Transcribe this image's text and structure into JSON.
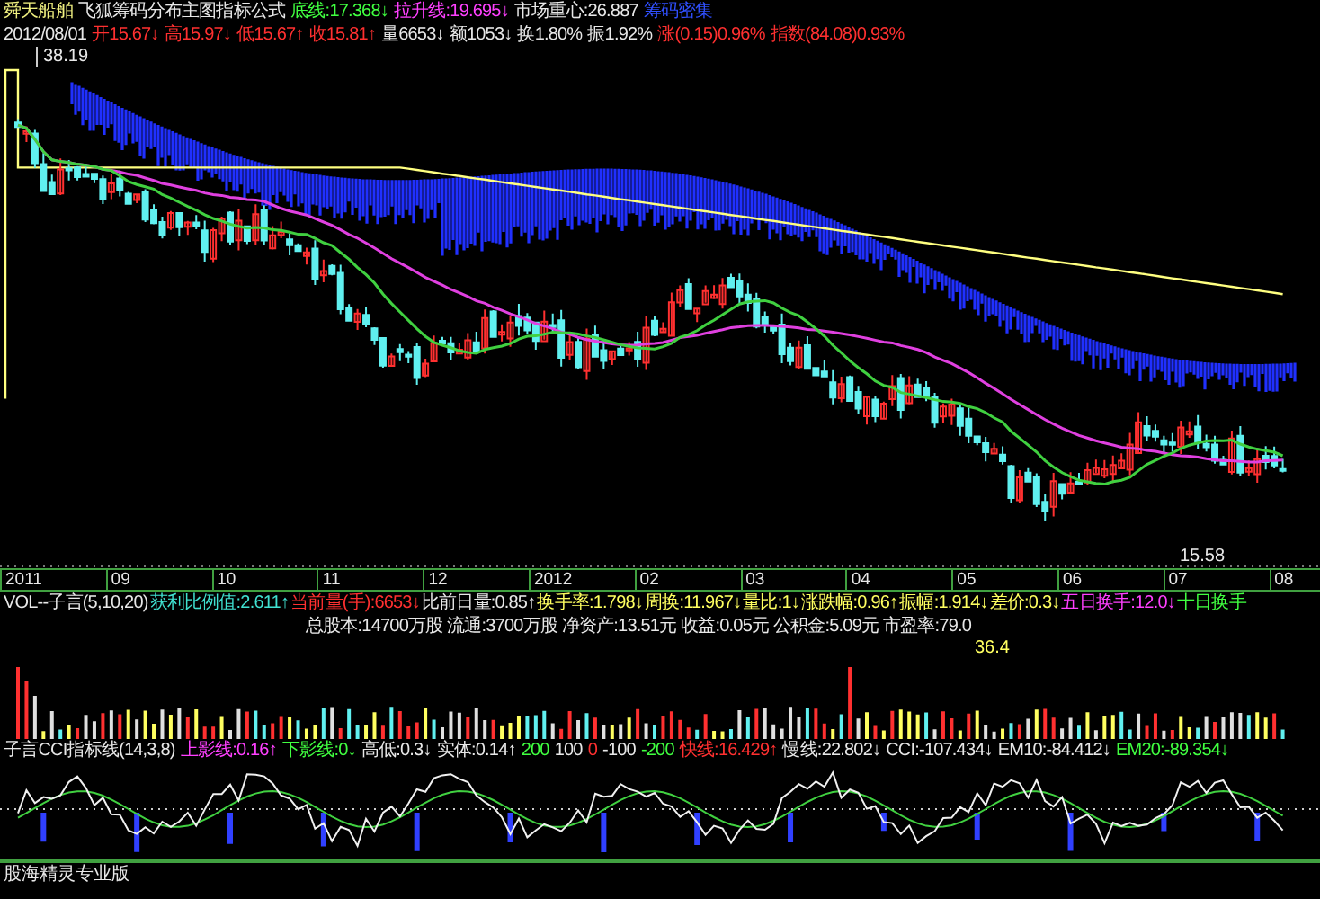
{
  "header": {
    "line_1": [
      {
        "text": "舜天船舶",
        "color": "#f0f080"
      },
      {
        "text": "飞狐筹码分布主图指标公式",
        "color": "#e8e8e8"
      },
      {
        "text": "底线:17.368↓",
        "color": "#40ff40"
      },
      {
        "text": "拉升线:19.695↓",
        "color": "#ff40ff"
      },
      {
        "text": "市场重心:26.887",
        "color": "#e8e8e8"
      },
      {
        "text": "筹码密集",
        "color": "#3050ff"
      }
    ],
    "line_2": [
      {
        "text": "2012/08/01",
        "color": "#e8e8e8"
      },
      {
        "text": "开15.67↓",
        "color": "#ff3030"
      },
      {
        "text": "高15.97↓",
        "color": "#ff3030"
      },
      {
        "text": "低15.67↑",
        "color": "#ff3030"
      },
      {
        "text": "收15.81↑",
        "color": "#ff3030"
      },
      {
        "text": "量6653↓",
        "color": "#e8e8e8"
      },
      {
        "text": "额1053↓",
        "color": "#e8e8e8"
      },
      {
        "text": "换1.80%",
        "color": "#e8e8e8"
      },
      {
        "text": "振1.92%",
        "color": "#e8e8e8"
      },
      {
        "text": "涨(0.15)0.96%",
        "color": "#ff3030"
      },
      {
        "text": "指数(84.08)0.93%",
        "color": "#ff3030"
      }
    ]
  },
  "price_chart": {
    "high_label": "38.19",
    "low_label": "15.58"
  },
  "date_axis": [
    "2011",
    "09",
    "10",
    "11",
    "12",
    "2012",
    "02",
    "03",
    "04",
    "05",
    "06",
    "07",
    "08"
  ],
  "volume_panel": {
    "stats": [
      {
        "text": "VOL--子言(5,10,20)",
        "color": "#e8e8e8"
      },
      {
        "text": "获利比例值:2.611↑",
        "color": "#40e0d0"
      },
      {
        "text": "当前量(手):6653↓",
        "color": "#ff3030"
      },
      {
        "text": "比前日量:0.85↑",
        "color": "#e8e8e8"
      },
      {
        "text": "换手率:1.798↓",
        "color": "#ffff60"
      },
      {
        "text": "周换:11.967↓",
        "color": "#ffff60"
      },
      {
        "text": "量比:1↓",
        "color": "#ffff60"
      },
      {
        "text": "涨跌幅:0.96↑",
        "color": "#ffff60"
      },
      {
        "text": "振幅:1.914↓",
        "color": "#ffff60"
      },
      {
        "text": "差价:0.3↓",
        "color": "#ffff60"
      },
      {
        "text": "五日换手:12.0↓",
        "color": "#ff40ff"
      },
      {
        "text": "十日换手",
        "color": "#40ff40"
      }
    ],
    "fundamentals": "总股本:14700万股 流通:3700万股 净资产:13.51元 收益:0.05元 公积金:5.09元 市盈率:79.0",
    "peak_label": "36.4"
  },
  "cci_panel": {
    "stats": [
      {
        "text": "子言CCI指标线(14,3,8)",
        "color": "#e8e8e8"
      },
      {
        "text": "上影线:0.16↑",
        "color": "#ff40ff"
      },
      {
        "text": "下影线:0↓",
        "color": "#40ff40"
      },
      {
        "text": "高低:0.3↓",
        "color": "#e8e8e8"
      },
      {
        "text": "实体:0.14↑",
        "color": "#e8e8e8"
      },
      {
        "text": "200",
        "color": "#40ff40"
      },
      {
        "text": "100",
        "color": "#e8e8e8"
      },
      {
        "text": "0",
        "color": "#ff3030"
      },
      {
        "text": "-100",
        "color": "#e8e8e8"
      },
      {
        "text": "-200",
        "color": "#40ff40"
      },
      {
        "text": "快线:16.429↑",
        "color": "#ff3030"
      },
      {
        "text": "慢线:22.802↓",
        "color": "#e8e8e8"
      },
      {
        "text": "CCI:-107.434↓",
        "color": "#e8e8e8"
      },
      {
        "text": "EM10:-84.412↓",
        "color": "#e8e8e8"
      },
      {
        "text": "EM20:-89.354↓",
        "color": "#40ff40"
      }
    ]
  },
  "status_bar": "股海精灵专业版"
}
